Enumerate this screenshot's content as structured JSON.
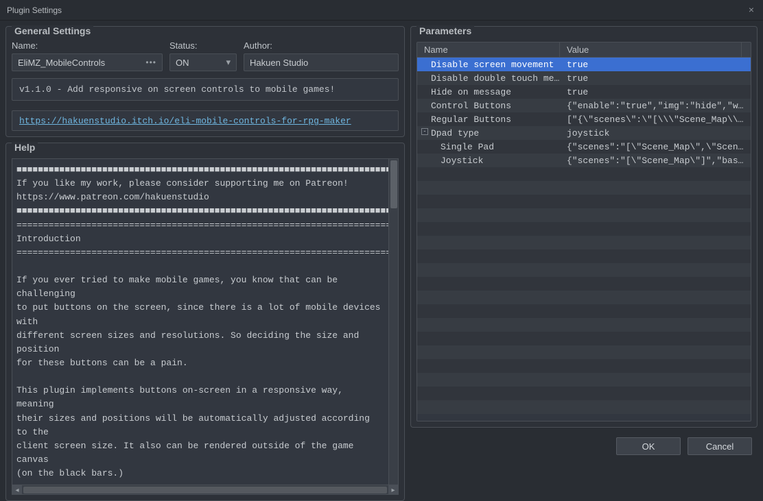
{
  "window": {
    "title": "Plugin Settings",
    "close_label": "×"
  },
  "general": {
    "legend": "General Settings",
    "name_label": "Name:",
    "status_label": "Status:",
    "author_label": "Author:",
    "name_value": "EliMZ_MobileControls",
    "status_value": "ON",
    "author_value": "Hakuen Studio",
    "description": "v1.1.0 - Add responsive on screen controls to mobile games!",
    "link_text": "https://hakuenstudio.itch.io/eli-mobile-controls-for-rpg-maker"
  },
  "help": {
    "legend": "Help",
    "text": "■■■■■■■■■■■■■■■■■■■■■■■■■■■■■■■■■■■■■■■■■■■■■■■■■■■■■■■■■■■■■■■■■■■■■■■■■■■\nIf you like my work, please consider supporting me on Patreon!\nhttps://www.patreon.com/hakuenstudio\n■■■■■■■■■■■■■■■■■■■■■■■■■■■■■■■■■■■■■■■■■■■■■■■■■■■■■■■■■■■■■■■■■■■■■■■■■■■\n============================================================================\nIntroduction\n============================================================================\n\nIf you ever tried to make mobile games, you know that can be challenging\nto put buttons on the screen, since there is a lot of mobile devices with\ndifferent screen sizes and resolutions. So deciding the size and position\nfor these buttons can be a pain.\n\nThis plugin implements buttons on-screen in a responsive way, meaning\ntheir sizes and positions will be automatically adjusted according to the\nclient screen size. It also can be rendered outside of the game canvas\n(on the black bars.)"
  },
  "params": {
    "legend": "Parameters",
    "col_name": "Name",
    "col_value": "Value",
    "rows": [
      {
        "name": "Disable screen movement",
        "value": "true",
        "indent": 0,
        "selected": true
      },
      {
        "name": "Disable double touch menu",
        "value": "true",
        "indent": 0
      },
      {
        "name": "Hide on message",
        "value": "true",
        "indent": 0
      },
      {
        "name": "Control Buttons",
        "value": "{\"enable\":\"true\",\"img\":\"hide\",\"w…",
        "indent": 0
      },
      {
        "name": "Regular Buttons",
        "value": "[\"{\\\"scenes\\\":\\\"[\\\\\\\"Scene_Map\\\\…",
        "indent": 0
      },
      {
        "name": "Dpad type",
        "value": "joystick",
        "indent": 0,
        "expander": "-"
      },
      {
        "name": "Single Pad",
        "value": "{\"scenes\":\"[\\\"Scene_Map\\\",\\\"Scen…",
        "indent": 1
      },
      {
        "name": "Joystick",
        "value": "{\"scenes\":\"[\\\"Scene_Map\\\"]\",\"bas…",
        "indent": 1
      }
    ]
  },
  "footer": {
    "ok": "OK",
    "cancel": "Cancel"
  }
}
